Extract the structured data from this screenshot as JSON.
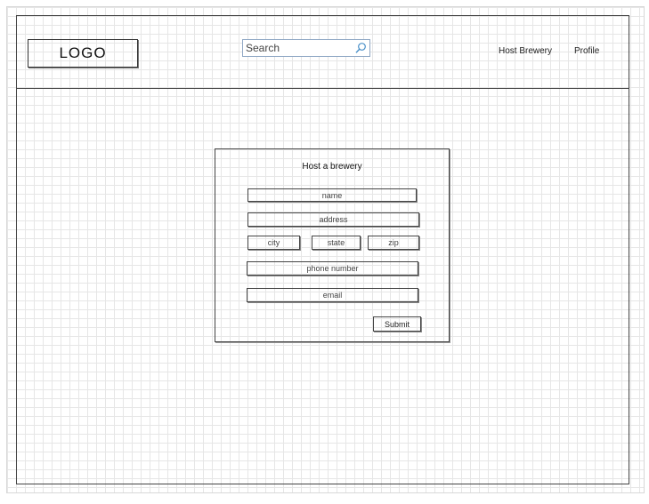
{
  "header": {
    "logo": "LOGO",
    "search_placeholder": "Search",
    "nav": [
      "Host Brewery",
      "Profile"
    ]
  },
  "form": {
    "title": "Host a brewery",
    "fields": {
      "name": "name",
      "address": "address",
      "city": "city",
      "state": "state",
      "zip": "zip",
      "phone": "phone number",
      "email": "email"
    },
    "submit_label": "Submit"
  },
  "colors": {
    "line": "#444444",
    "grid": "#e6e6e6",
    "search_border": "#8fa7c4",
    "search_icon": "#4a90c8"
  },
  "icons": {
    "search": "search-icon"
  }
}
